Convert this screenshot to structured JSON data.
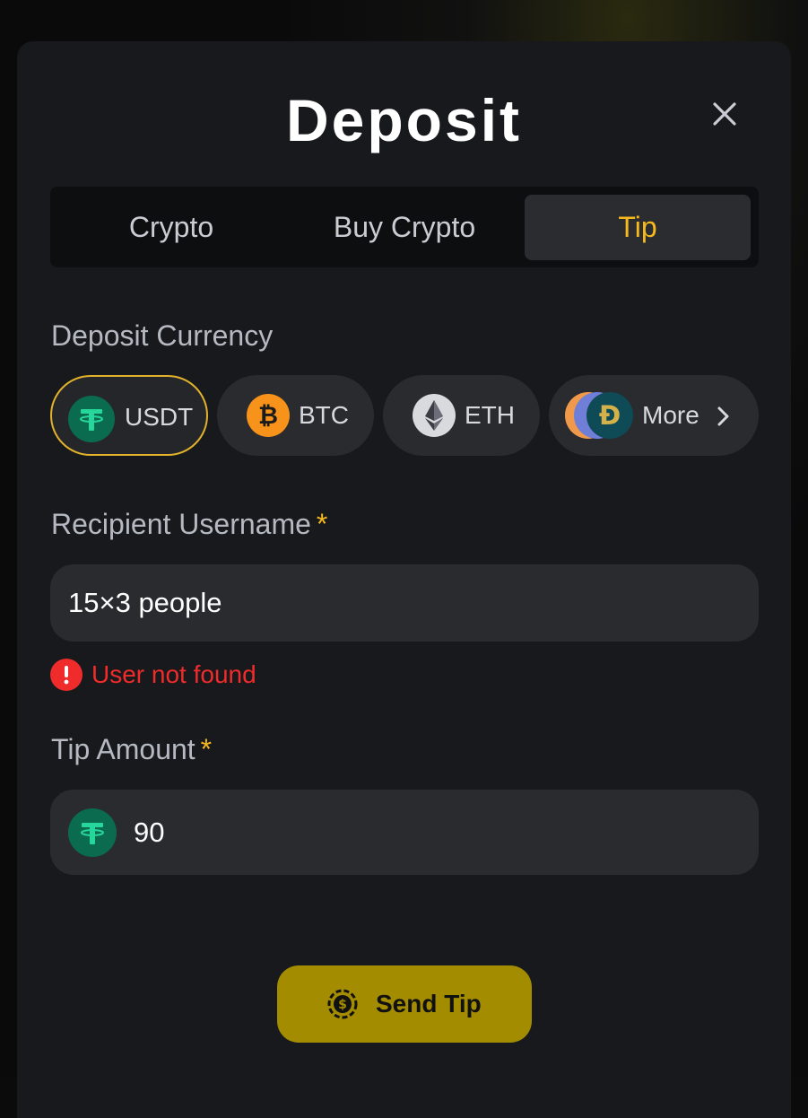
{
  "modal": {
    "title": "Deposit",
    "close_icon": "close-icon"
  },
  "tabs": [
    {
      "label": "Crypto",
      "active": false
    },
    {
      "label": "Buy Crypto",
      "active": false
    },
    {
      "label": "Tip",
      "active": true
    }
  ],
  "currency": {
    "label": "Deposit Currency",
    "options": [
      {
        "label": "USDT",
        "icon": "usdt-icon",
        "color": "#0b6b4f",
        "selected": true
      },
      {
        "label": "BTC",
        "icon": "btc-icon",
        "color": "#f7931a",
        "selected": false
      },
      {
        "label": "ETH",
        "icon": "eth-icon",
        "color": "#d9dadd",
        "selected": false
      },
      {
        "label": "More",
        "icon": "more-coins-icon",
        "color": "#1d4f5e",
        "selected": false
      }
    ]
  },
  "recipient": {
    "label": "Recipient Username",
    "required_mark": "*",
    "value": "15×3 people",
    "error": "User not found"
  },
  "amount": {
    "label": "Tip Amount",
    "required_mark": "*",
    "value": "90",
    "currency_icon": "usdt-icon"
  },
  "send_button": {
    "label": "Send Tip",
    "icon": "coin-icon"
  },
  "colors": {
    "accent": "#f5b81f",
    "error": "#ef2b2b",
    "button": "#a38c00",
    "modal_bg": "#18191c"
  }
}
